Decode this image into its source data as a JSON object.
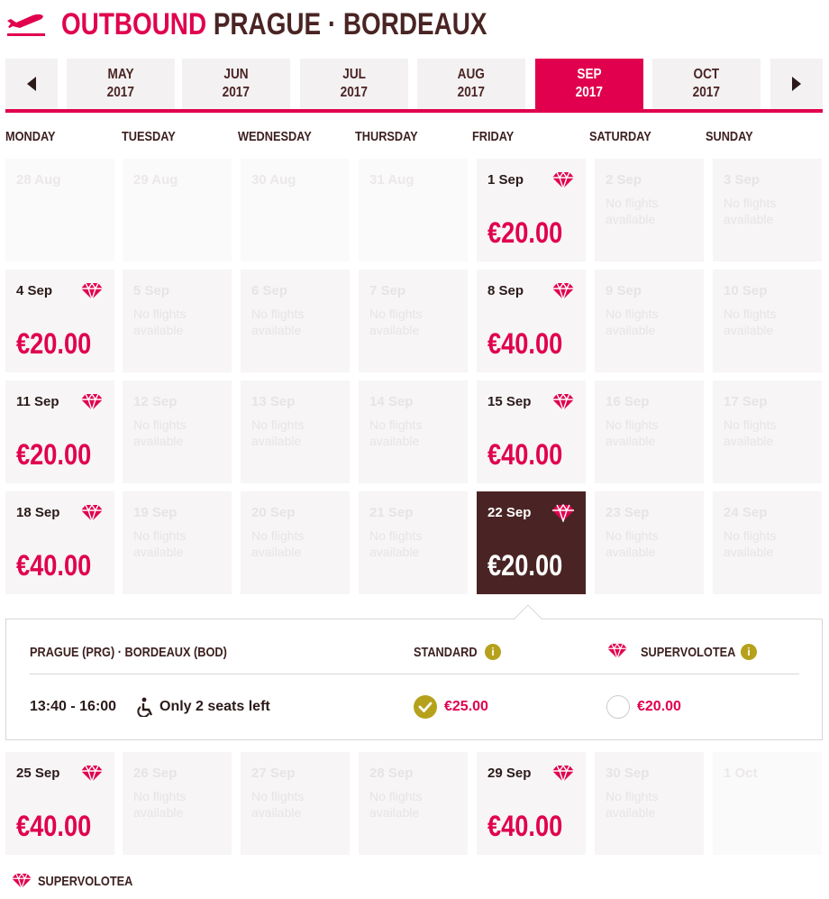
{
  "header": {
    "direction": "OUTBOUND",
    "route": "PRAGUE · BORDEAUX"
  },
  "months": [
    {
      "month": "MAY",
      "year": "2017",
      "active": false
    },
    {
      "month": "JUN",
      "year": "2017",
      "active": false
    },
    {
      "month": "JUL",
      "year": "2017",
      "active": false
    },
    {
      "month": "AUG",
      "year": "2017",
      "active": false
    },
    {
      "month": "SEP",
      "year": "2017",
      "active": true
    },
    {
      "month": "OCT",
      "year": "2017",
      "active": false
    }
  ],
  "weekdays": [
    "MONDAY",
    "TUESDAY",
    "WEDNESDAY",
    "THURSDAY",
    "FRIDAY",
    "SATURDAY",
    "SUNDAY"
  ],
  "no_flights_text": "No flights available",
  "weeks": [
    [
      {
        "date": "28 Aug",
        "state": "outside"
      },
      {
        "date": "29 Aug",
        "state": "outside"
      },
      {
        "date": "30 Aug",
        "state": "outside"
      },
      {
        "date": "31 Aug",
        "state": "outside"
      },
      {
        "date": "1 Sep",
        "state": "available",
        "price": "€20.00",
        "supervolotea": true
      },
      {
        "date": "2 Sep",
        "state": "disabled"
      },
      {
        "date": "3 Sep",
        "state": "disabled"
      }
    ],
    [
      {
        "date": "4 Sep",
        "state": "available",
        "price": "€20.00",
        "supervolotea": true
      },
      {
        "date": "5 Sep",
        "state": "disabled"
      },
      {
        "date": "6 Sep",
        "state": "disabled"
      },
      {
        "date": "7 Sep",
        "state": "disabled"
      },
      {
        "date": "8 Sep",
        "state": "available",
        "price": "€40.00",
        "supervolotea": true
      },
      {
        "date": "9 Sep",
        "state": "disabled"
      },
      {
        "date": "10 Sep",
        "state": "disabled"
      }
    ],
    [
      {
        "date": "11 Sep",
        "state": "available",
        "price": "€20.00",
        "supervolotea": true
      },
      {
        "date": "12 Sep",
        "state": "disabled"
      },
      {
        "date": "13 Sep",
        "state": "disabled"
      },
      {
        "date": "14 Sep",
        "state": "disabled"
      },
      {
        "date": "15 Sep",
        "state": "available",
        "price": "€40.00",
        "supervolotea": true
      },
      {
        "date": "16 Sep",
        "state": "disabled"
      },
      {
        "date": "17 Sep",
        "state": "disabled"
      }
    ],
    [
      {
        "date": "18 Sep",
        "state": "available",
        "price": "€40.00",
        "supervolotea": true
      },
      {
        "date": "19 Sep",
        "state": "disabled"
      },
      {
        "date": "20 Sep",
        "state": "disabled"
      },
      {
        "date": "21 Sep",
        "state": "disabled"
      },
      {
        "date": "22 Sep",
        "state": "selected",
        "price": "€20.00",
        "supervolotea": true
      },
      {
        "date": "23 Sep",
        "state": "disabled"
      },
      {
        "date": "24 Sep",
        "state": "disabled"
      }
    ],
    [
      {
        "date": "25 Sep",
        "state": "available",
        "price": "€40.00",
        "supervolotea": true
      },
      {
        "date": "26 Sep",
        "state": "disabled"
      },
      {
        "date": "27 Sep",
        "state": "disabled"
      },
      {
        "date": "28 Sep",
        "state": "disabled"
      },
      {
        "date": "29 Sep",
        "state": "available",
        "price": "€40.00",
        "supervolotea": true
      },
      {
        "date": "30 Sep",
        "state": "disabled"
      },
      {
        "date": "1 Oct",
        "state": "outside"
      }
    ]
  ],
  "details": {
    "route": "PRAGUE (PRG) · BORDEAUX (BOD)",
    "standard_label": "STANDARD",
    "supervolotea_label": "SUPERVOLOTEA",
    "info_glyph": "i",
    "time": "13:40 - 16:00",
    "seats": "Only 2 seats left",
    "standard_price": "€25.00",
    "standard_selected": true,
    "supervolotea_price": "€20.00",
    "supervolotea_selected": false
  },
  "legend": {
    "label": "SUPERVOLOTEA"
  },
  "colors": {
    "accent": "#e0004d",
    "selected_cell": "#4a2424",
    "check": "#b6a11c"
  }
}
